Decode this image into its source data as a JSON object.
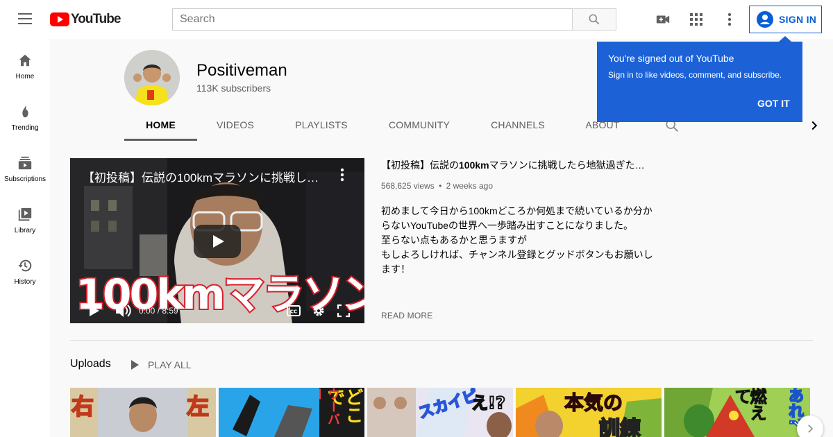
{
  "topbar": {
    "logo_text": "YouTube",
    "search_placeholder": "Search",
    "signin_label": "SIGN IN",
    "icons": [
      "menu-icon",
      "search-icon",
      "video-camera-icon",
      "apps-grid-icon",
      "more-vert-icon",
      "account-circle-icon"
    ]
  },
  "sidebar": {
    "items": [
      {
        "label": "Home",
        "icon": "home-icon"
      },
      {
        "label": "Trending",
        "icon": "flame-icon"
      },
      {
        "label": "Subscriptions",
        "icon": "subscriptions-icon"
      },
      {
        "label": "Library",
        "icon": "library-icon"
      },
      {
        "label": "History",
        "icon": "history-icon"
      }
    ]
  },
  "channel": {
    "name": "Positiveman",
    "subscribers": "113K subscribers",
    "tabs": [
      {
        "label": "Home",
        "active": true
      },
      {
        "label": "Videos",
        "active": false
      },
      {
        "label": "Playlists",
        "active": false
      },
      {
        "label": "Community",
        "active": false
      },
      {
        "label": "Channels",
        "active": false
      },
      {
        "label": "About",
        "active": false
      }
    ]
  },
  "featured": {
    "player_title": "【初投稿】伝説の100kmマラソンに挑戦し…",
    "overlay_text": "100kmマラソン",
    "time": "0:00 / 8:59",
    "title_prefix": "【初投稿】伝説の",
    "title_bold": "100km",
    "title_suffix": "マラソンに挑戦したら地獄過ぎた…",
    "views": "568,625 views",
    "separator": "•",
    "age": "2 weeks ago",
    "description": [
      "初めまして今日から100kmどころか何処まで続いているか分か",
      "らないYouTubeの世界へ一歩踏み出すことになりました。",
      "至らない点もあるかと思うますが",
      "もしよろしければ、チャンネル登録とグッドボタンもお願いし",
      "ます！"
    ],
    "read_more": "READ MORE"
  },
  "uploads": {
    "title": "Uploads",
    "play_all": "PLAY ALL",
    "thumbnails": [
      {
        "text": "右",
        "text2": "左"
      },
      {
        "text": "どこで",
        "text2": "ウーバー"
      },
      {
        "text": "スカイピ",
        "text2": "え!?"
      },
      {
        "text": "本気の",
        "text2": "訓練"
      },
      {
        "text": "燃えて",
        "text2": "あれ?"
      }
    ]
  },
  "popup": {
    "title": "You're signed out of YouTube",
    "text": "Sign in to like videos, comment, and subscribe.",
    "button": "GOT IT"
  },
  "colors": {
    "brand_red": "#ff0000",
    "link_blue": "#065fd4",
    "popup_blue": "#1c62d6"
  }
}
